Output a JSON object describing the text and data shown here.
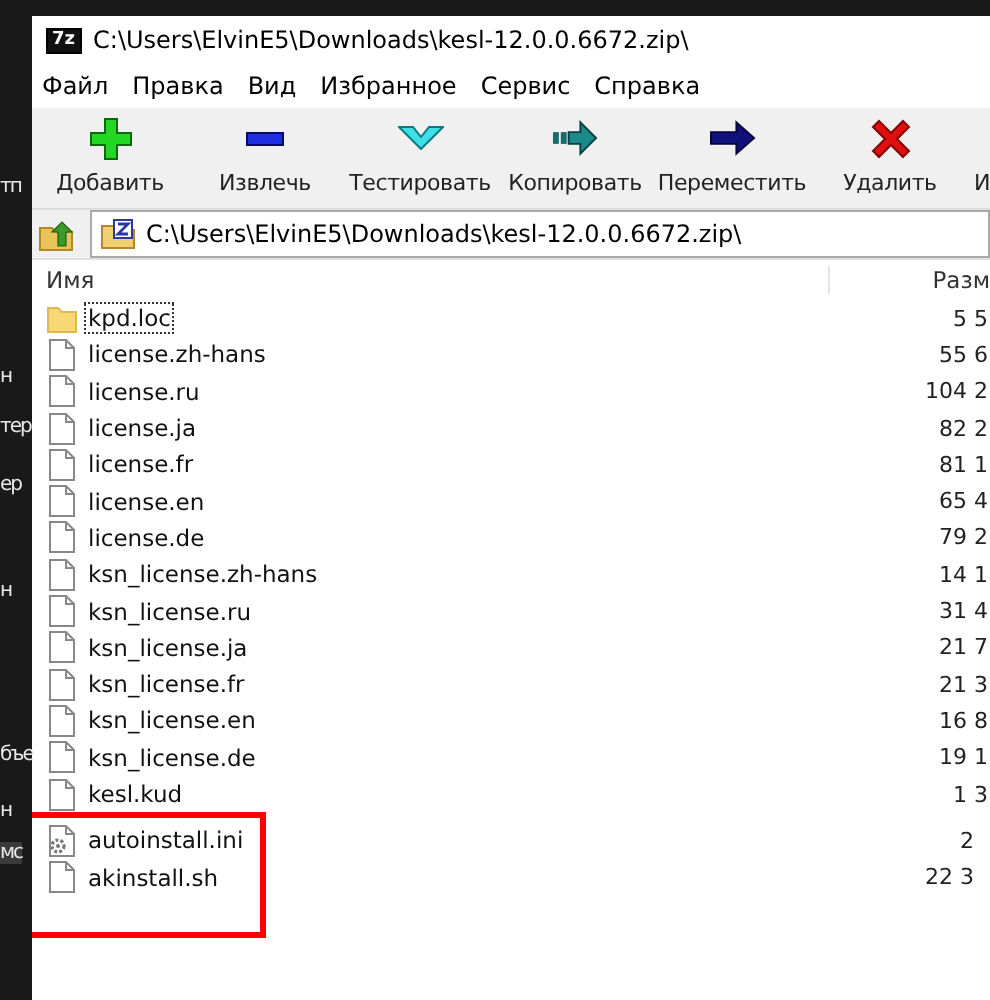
{
  "background_fragments": [
    "тп",
    "н",
    "тер",
    "ер",
    "н",
    "бъе",
    "н",
    "мс"
  ],
  "window": {
    "logo": "7z",
    "title": "C:\\Users\\ElvinE5\\Downloads\\kesl-12.0.0.6672.zip\\"
  },
  "menu": [
    "Файл",
    "Правка",
    "Вид",
    "Избранное",
    "Сервис",
    "Справка"
  ],
  "toolbar": [
    {
      "kind": "add",
      "label": "Добавить"
    },
    {
      "kind": "extract",
      "label": "Извлечь"
    },
    {
      "kind": "test",
      "label": "Тестировать"
    },
    {
      "kind": "copy",
      "label": "Копировать"
    },
    {
      "kind": "move",
      "label": "Переместить"
    },
    {
      "kind": "delete",
      "label": "Удалить"
    },
    {
      "kind": "none",
      "label": "И"
    }
  ],
  "address": {
    "value": "C:\\Users\\ElvinE5\\Downloads\\kesl-12.0.0.6672.zip\\"
  },
  "table": {
    "columns": [
      "Имя",
      "Разм"
    ],
    "rows": [
      {
        "kind": "folder",
        "name": "kpd.loc",
        "size": "5 5",
        "focused": true,
        "highlighted": false
      },
      {
        "kind": "file",
        "name": "license.zh-hans",
        "size": "55 6",
        "focused": false,
        "highlighted": false
      },
      {
        "kind": "file",
        "name": "license.ru",
        "size": "104 2",
        "focused": false,
        "highlighted": false
      },
      {
        "kind": "file",
        "name": "license.ja",
        "size": "82 2",
        "focused": false,
        "highlighted": false
      },
      {
        "kind": "file",
        "name": "license.fr",
        "size": "81 1",
        "focused": false,
        "highlighted": false
      },
      {
        "kind": "file",
        "name": "license.en",
        "size": "65 4",
        "focused": false,
        "highlighted": false
      },
      {
        "kind": "file",
        "name": "license.de",
        "size": "79 2",
        "focused": false,
        "highlighted": false
      },
      {
        "kind": "file",
        "name": "ksn_license.zh-hans",
        "size": "14 1",
        "focused": false,
        "highlighted": false
      },
      {
        "kind": "file",
        "name": "ksn_license.ru",
        "size": "31 4",
        "focused": false,
        "highlighted": false
      },
      {
        "kind": "file",
        "name": "ksn_license.ja",
        "size": "21 7",
        "focused": false,
        "highlighted": false
      },
      {
        "kind": "file",
        "name": "ksn_license.fr",
        "size": "21 3",
        "focused": false,
        "highlighted": false
      },
      {
        "kind": "file",
        "name": "ksn_license.en",
        "size": "16 8",
        "focused": false,
        "highlighted": false
      },
      {
        "kind": "file",
        "name": "ksn_license.de",
        "size": "19 1",
        "focused": false,
        "highlighted": false
      },
      {
        "kind": "file",
        "name": "kesl.kud",
        "size": "1 3",
        "focused": false,
        "highlighted": false
      },
      {
        "kind": "config",
        "name": "autoinstall.ini",
        "size": "2",
        "focused": false,
        "highlighted": true
      },
      {
        "kind": "file",
        "name": "akinstall.sh",
        "size": "22 3",
        "focused": false,
        "highlighted": true
      }
    ]
  }
}
